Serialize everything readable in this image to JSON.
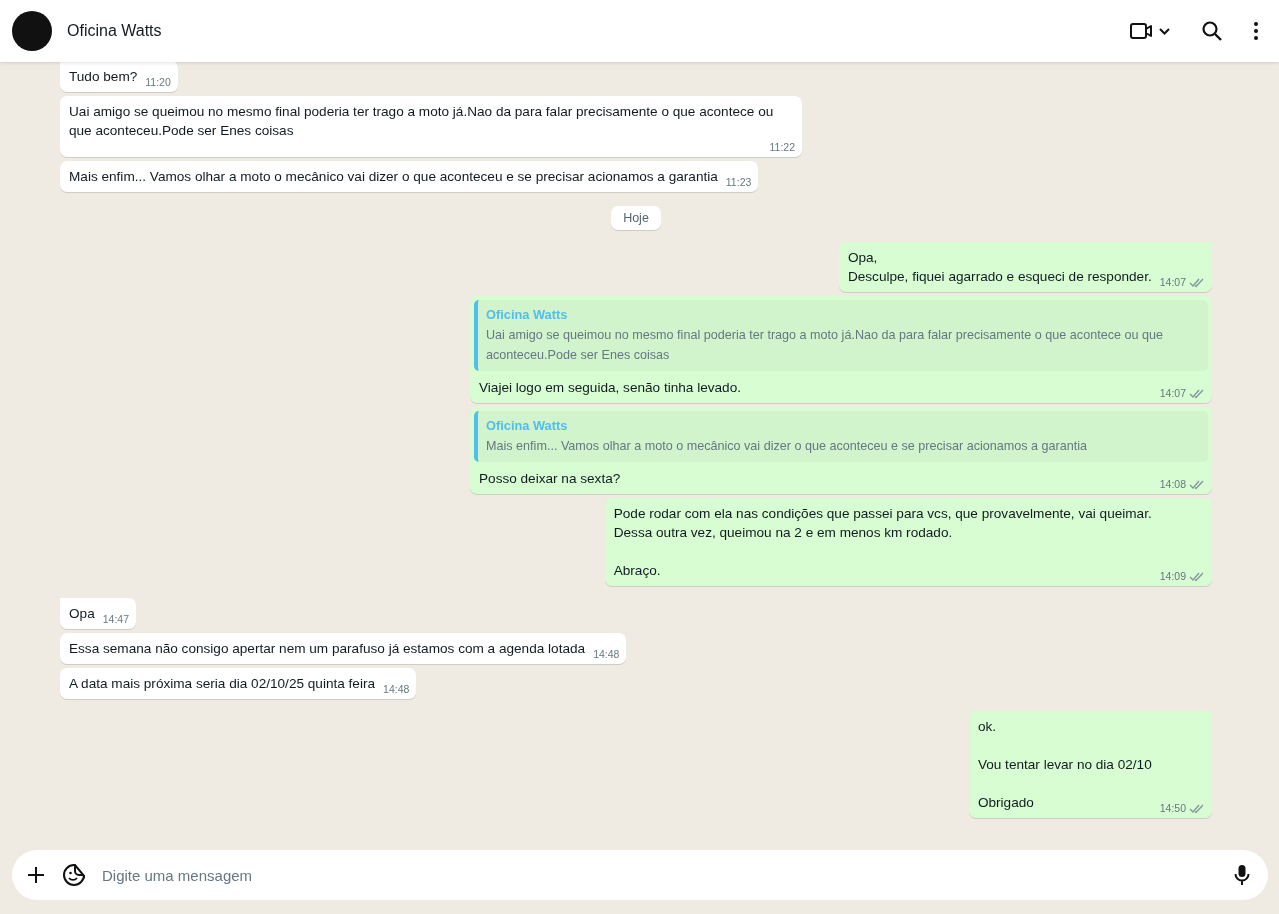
{
  "header": {
    "contact_name": "Oficina Watts"
  },
  "groups": [
    {
      "kind": "incoming",
      "messages": [
        {
          "text": "Tudo bem?",
          "time": "11:20"
        },
        {
          "text": "Uai amigo se queimou no mesmo final poderia ter trago a moto já.Nao da para falar precisamente o que acontece   ou que aconteceu.Pode ser Enes coisas",
          "time": "11:22"
        },
        {
          "text": "Mais enfim... Vamos olhar a moto o mecânico vai dizer o que aconteceu e se precisar acionamos a garantia",
          "time": "11:23"
        }
      ]
    },
    {
      "kind": "date",
      "label": "Hoje"
    },
    {
      "kind": "outgoing",
      "messages": [
        {
          "text": "Opa,\nDesculpe, fiquei agarrado e esqueci de responder.",
          "time": "14:07"
        },
        {
          "quote": {
            "author": "Oficina Watts",
            "text": "Uai amigo se queimou no mesmo final poderia ter trago a moto já.Nao da para falar precisamente o que acontece   ou que aconteceu.Pode ser Enes coisas"
          },
          "text": "Viajei logo em seguida, senão tinha levado.",
          "time": "14:07"
        },
        {
          "quote": {
            "author": "Oficina Watts",
            "text": "Mais enfim... Vamos olhar a moto o mecânico vai dizer o que aconteceu e se precisar acionamos a garantia"
          },
          "text": "Posso deixar na sexta?",
          "time": "14:08"
        },
        {
          "text": "Pode rodar com ela nas condições que passei para vcs, que provavelmente, vai queimar.\nDessa outra vez, queimou na 2 e em menos km rodado.\n\nAbraço.",
          "time": "14:09"
        }
      ]
    },
    {
      "kind": "incoming",
      "messages": [
        {
          "text": "Opa",
          "time": "14:47"
        },
        {
          "text": "Essa semana não consigo apertar nem um parafuso já estamos com a agenda lotada",
          "time": "14:48"
        },
        {
          "text": "A data mais próxima seria dia 02/10/25 quinta feira",
          "time": "14:48"
        }
      ]
    },
    {
      "kind": "outgoing",
      "messages": [
        {
          "text": "ok.\n\nVou tentar levar no dia 02/10\n\nObrigado",
          "time": "14:50"
        }
      ]
    }
  ],
  "composer": {
    "placeholder": "Digite uma mensagem"
  }
}
